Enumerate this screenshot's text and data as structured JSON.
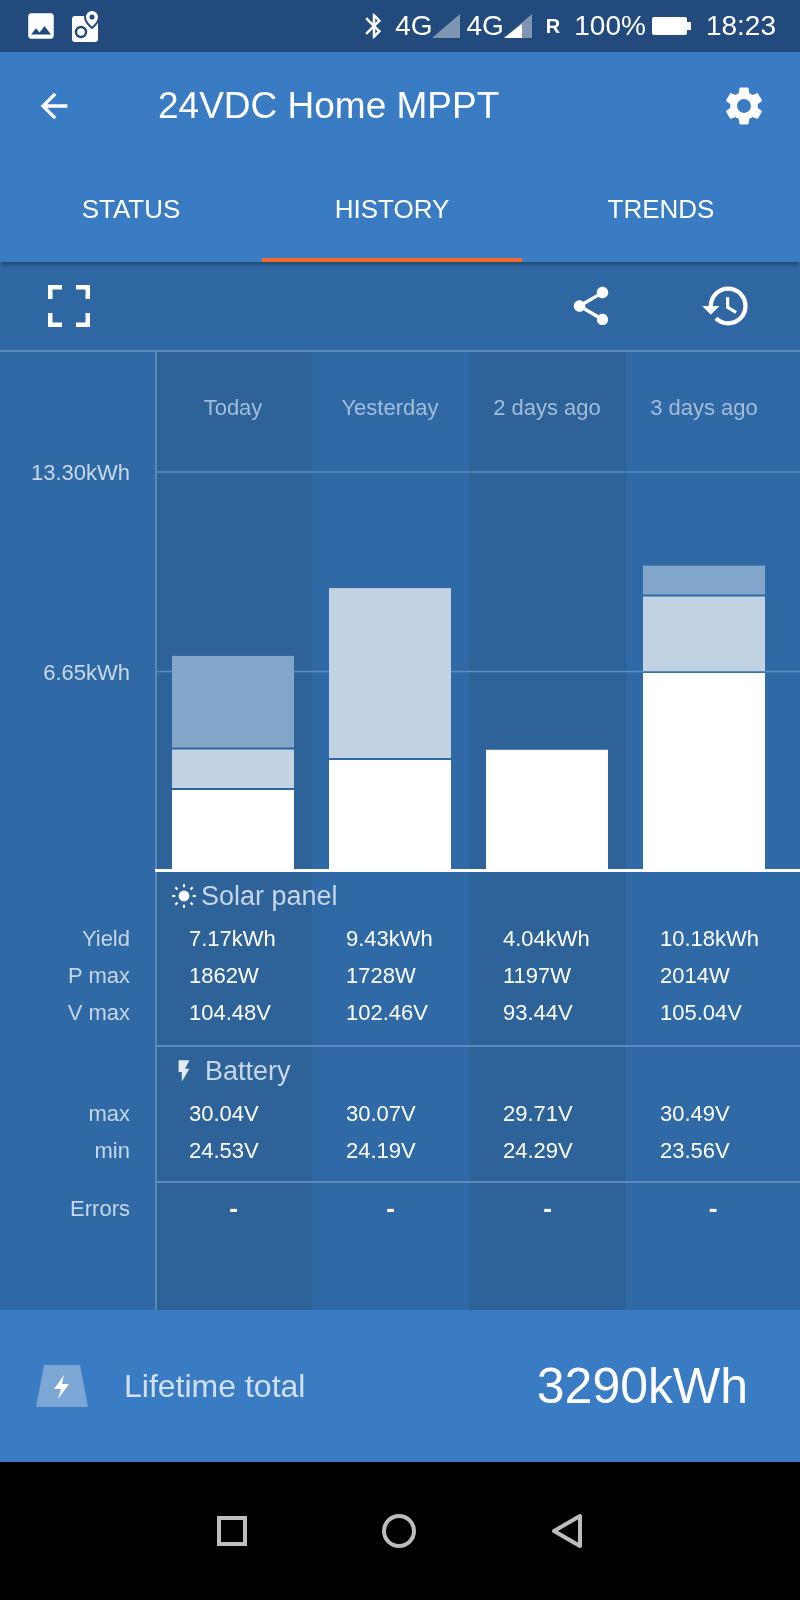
{
  "status_bar": {
    "network_1": "4G",
    "network_2": "4G",
    "roaming": "R",
    "battery": "100%",
    "time": "18:23"
  },
  "app_bar": {
    "title": "24VDC Home MPPT"
  },
  "tabs": [
    {
      "label": "STATUS",
      "selected": false
    },
    {
      "label": "HISTORY",
      "selected": true
    },
    {
      "label": "TRENDS",
      "selected": false
    }
  ],
  "history": {
    "chart_data": {
      "type": "bar",
      "stacked": true,
      "categories": [
        "Today",
        "Yesterday",
        "2 days ago",
        "3 days ago"
      ],
      "ylim": [
        0,
        17.3
      ],
      "yticks": [
        {
          "value": 6.65,
          "label": "6.65kWh"
        },
        {
          "value": 13.3,
          "label": "13.30kWh"
        }
      ],
      "series": [
        {
          "color": "#ffffff",
          "values": [
            2.7,
            3.7,
            4.04,
            6.6
          ]
        },
        {
          "color": "#c1d2e3",
          "values": [
            1.35,
            5.73,
            null,
            2.55
          ]
        },
        {
          "color": "#82a6ca",
          "values": [
            3.12,
            null,
            null,
            1.03
          ]
        }
      ]
    },
    "sections": [
      {
        "kind": "solar",
        "title": "Solar panel",
        "rows": [
          {
            "label": "Yield",
            "values": [
              "7.17kWh",
              "9.43kWh",
              "4.04kWh",
              "10.18kWh"
            ]
          },
          {
            "label": "P max",
            "values": [
              "1862W",
              "1728W",
              "1197W",
              "2014W"
            ]
          },
          {
            "label": "V max",
            "values": [
              "104.48V",
              "102.46V",
              "93.44V",
              "105.04V"
            ]
          }
        ]
      },
      {
        "kind": "battery",
        "title": "Battery",
        "rows": [
          {
            "label": "max",
            "values": [
              "30.04V",
              "30.07V",
              "29.71V",
              "30.49V"
            ]
          },
          {
            "label": "min",
            "values": [
              "24.53V",
              "24.19V",
              "24.29V",
              "23.56V"
            ]
          }
        ]
      },
      {
        "kind": "plain",
        "rows": [
          {
            "label": "Errors",
            "values": [
              "-",
              "-",
              "-",
              "-"
            ]
          }
        ]
      }
    ]
  },
  "footer": {
    "label": "Lifetime total",
    "value": "3290kWh"
  }
}
